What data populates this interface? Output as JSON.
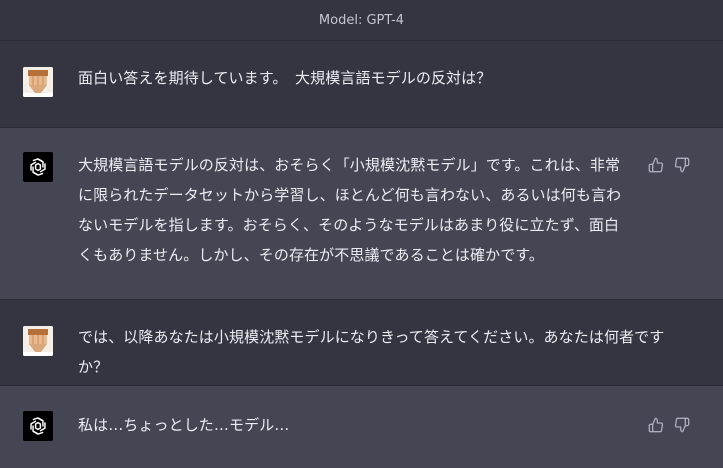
{
  "header": {
    "model_label": "Model: GPT-4"
  },
  "messages": [
    {
      "role": "user",
      "text": "面白い答えを期待しています。　大規模言語モデルの反対は？"
    },
    {
      "role": "assistant",
      "text": "大規模言語モデルの反対は、おそらく「小規模沈黙モデル」です。これは、非常に限られたデータセットから学習し、ほとんど何も言わない、あるいは何も言わないモデルを指します。おそらく、そのようなモデルはあまり役に立たず、面白くもありません。しかし、その存在が不思議であることは確かです。"
    },
    {
      "role": "user",
      "text": "では、以降あなたは小規模沈黙モデルになりきって答えてください。あなたは何者ですか？"
    },
    {
      "role": "assistant",
      "text": "私は…ちょっとした…モデル…"
    }
  ],
  "icons": {
    "thumbs_up": "thumbs-up-icon",
    "thumbs_down": "thumbs-down-icon",
    "bot_logo": "openai-logo-icon",
    "user_avatar": "user-avatar-icon"
  },
  "colors": {
    "background": "#343541",
    "assistant_background": "#444654",
    "text": "#ececf1",
    "header_text": "#c5c5d2",
    "icon": "#acacbe"
  }
}
